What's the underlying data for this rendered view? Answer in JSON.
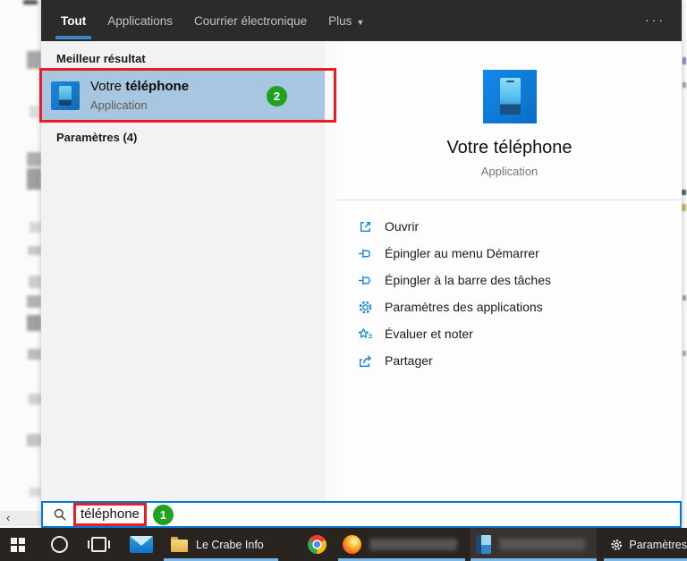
{
  "header": {
    "tabs": [
      {
        "label": "Tout"
      },
      {
        "label": "Applications"
      },
      {
        "label": "Courrier électronique"
      },
      {
        "label": "Plus"
      }
    ],
    "more_dots": "···"
  },
  "results": {
    "best_section_title": "Meilleur résultat",
    "best": {
      "title_prefix": "Votre ",
      "title_bold": "téléphone",
      "subtitle": "Application"
    },
    "settings_section_title": "Paramètres (4)"
  },
  "detail": {
    "title": "Votre téléphone",
    "subtitle": "Application",
    "actions": [
      {
        "icon": "open-icon",
        "label": "Ouvrir"
      },
      {
        "icon": "pin-icon",
        "label": "Épingler au menu Démarrer"
      },
      {
        "icon": "pin-icon",
        "label": "Épingler à la barre des tâches"
      },
      {
        "icon": "gear-icon",
        "label": "Paramètres des applications"
      },
      {
        "icon": "rate-icon",
        "label": "Évaluer et noter"
      },
      {
        "icon": "share-icon",
        "label": "Partager"
      }
    ]
  },
  "search": {
    "value": "téléphone"
  },
  "annotations": {
    "result_step": "2",
    "search_step": "1"
  },
  "taskbar": {
    "folder_label": "Le Crabe Info",
    "settings_label": "Paramètres"
  },
  "page": {
    "scroll_left_arrow": "‹"
  },
  "colors": {
    "accent_blue": "#0078d7",
    "annotation_red": "#ec1c24",
    "badge_green": "#1fa31f",
    "selection_blue": "#a8c6e0",
    "header_dark": "#2b2b2b",
    "taskbar_dark": "#29241f",
    "taskbar_underline": "#79b7e8"
  }
}
